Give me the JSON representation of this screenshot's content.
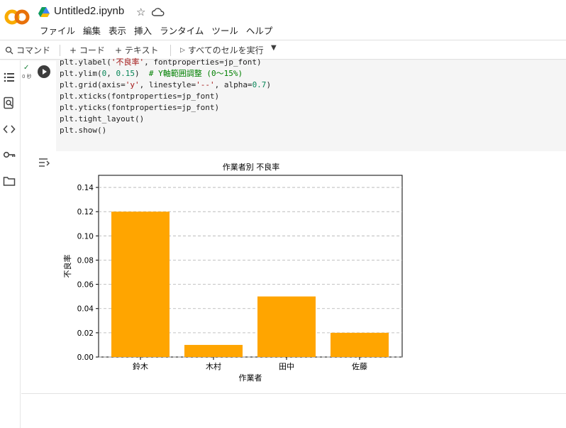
{
  "app": {
    "doc_title": "Untitled2.ipynb"
  },
  "menu": [
    "ファイル",
    "編集",
    "表示",
    "挿入",
    "ランタイム",
    "ツール",
    "ヘルプ"
  ],
  "toolbar": {
    "command": "コマンド",
    "add_code": "+ コード",
    "add_text": "+ テキスト",
    "run_all": "すべてのセルを実行"
  },
  "cell": {
    "status_time": "0 秒",
    "code_lines": [
      "plt.ylabel('不良率', fontproperties=jp_font)",
      "plt.ylim(0, 0.15)  # Y軸範囲調整 (0〜15%)",
      "plt.grid(axis='y', linestyle='--', alpha=0.7)",
      "plt.xticks(fontproperties=jp_font)",
      "plt.yticks(fontproperties=jp_font)",
      "plt.tight_layout()",
      "plt.show()"
    ]
  },
  "colors": {
    "bar": "#FFA500",
    "accent": "#F9AB00"
  },
  "chart_data": {
    "type": "bar",
    "title": "作業者別 不良率",
    "xlabel": "作業者",
    "ylabel": "不良率",
    "categories": [
      "鈴木",
      "木村",
      "田中",
      "佐藤"
    ],
    "values": [
      0.12,
      0.01,
      0.05,
      0.02
    ],
    "ylim": [
      0,
      0.15
    ],
    "yticks": [
      "0.00",
      "0.02",
      "0.04",
      "0.06",
      "0.08",
      "0.10",
      "0.12",
      "0.14"
    ],
    "grid": "y dashed"
  }
}
